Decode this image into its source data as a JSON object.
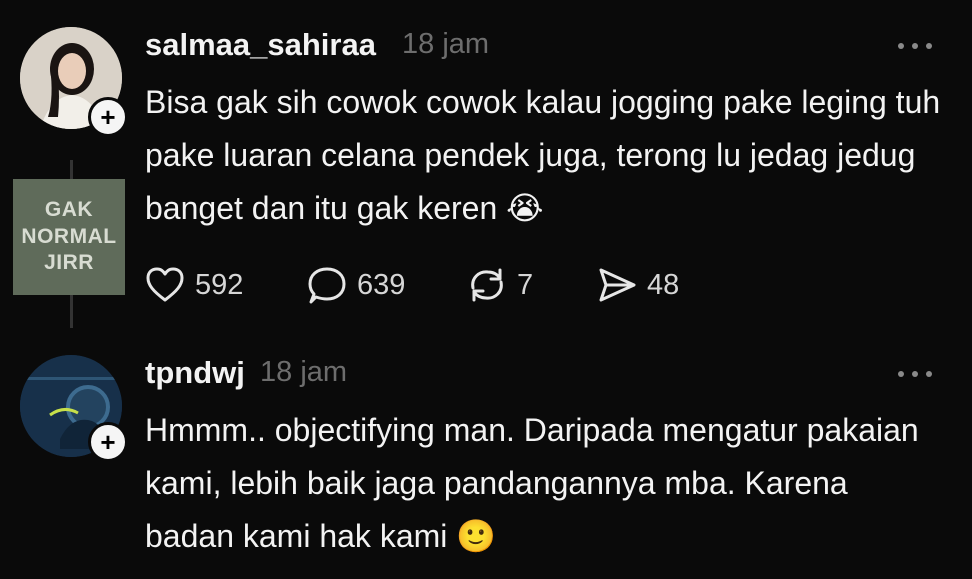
{
  "posts": [
    {
      "username": "salmaa_sahiraa",
      "time": "18 jam",
      "text": "Bisa gak sih cowok cowok kalau jogging pake leging tuh pake luaran celana pendek juga, terong lu jedag jedug banget  dan itu gak keren 😭",
      "meme_lines": [
        "GAK",
        "NORMAL",
        "JIRR"
      ],
      "likes": "592",
      "comments": "639",
      "reposts": "7",
      "shares": "48"
    },
    {
      "username": "tpndwj",
      "time": "18 jam",
      "text": "Hmmm.. objectifying man. Daripada mengatur pakaian kami, lebih baik jaga pandangannya mba. Karena badan kami hak kami 🙂"
    }
  ],
  "icons": {
    "like": "heart-icon",
    "comment": "speech-bubble-icon",
    "repost": "repost-icon",
    "share": "send-icon",
    "more": "more-dots-icon",
    "follow": "plus-icon"
  }
}
